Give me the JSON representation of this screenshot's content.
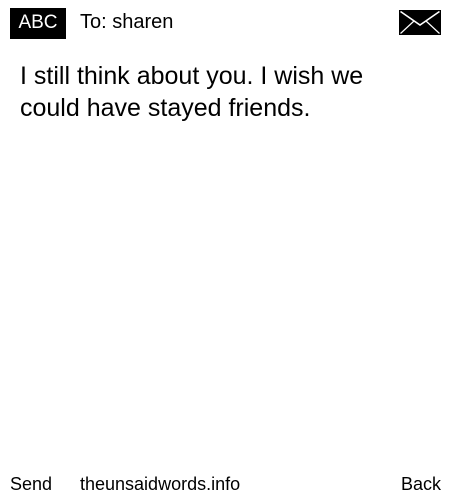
{
  "header": {
    "mode_label": "ABC",
    "recipient": "To: sharen",
    "mail_icon": "envelope-icon"
  },
  "message": {
    "text": "I still think about you. I wish we could have stayed friends."
  },
  "footer": {
    "send_label": "Send",
    "site_label": "theunsaidwords.info",
    "back_label": "Back"
  },
  "colors": {
    "background": "#ffffff",
    "text": "#000000",
    "badge_background": "#000000",
    "badge_text": "#ffffff"
  }
}
